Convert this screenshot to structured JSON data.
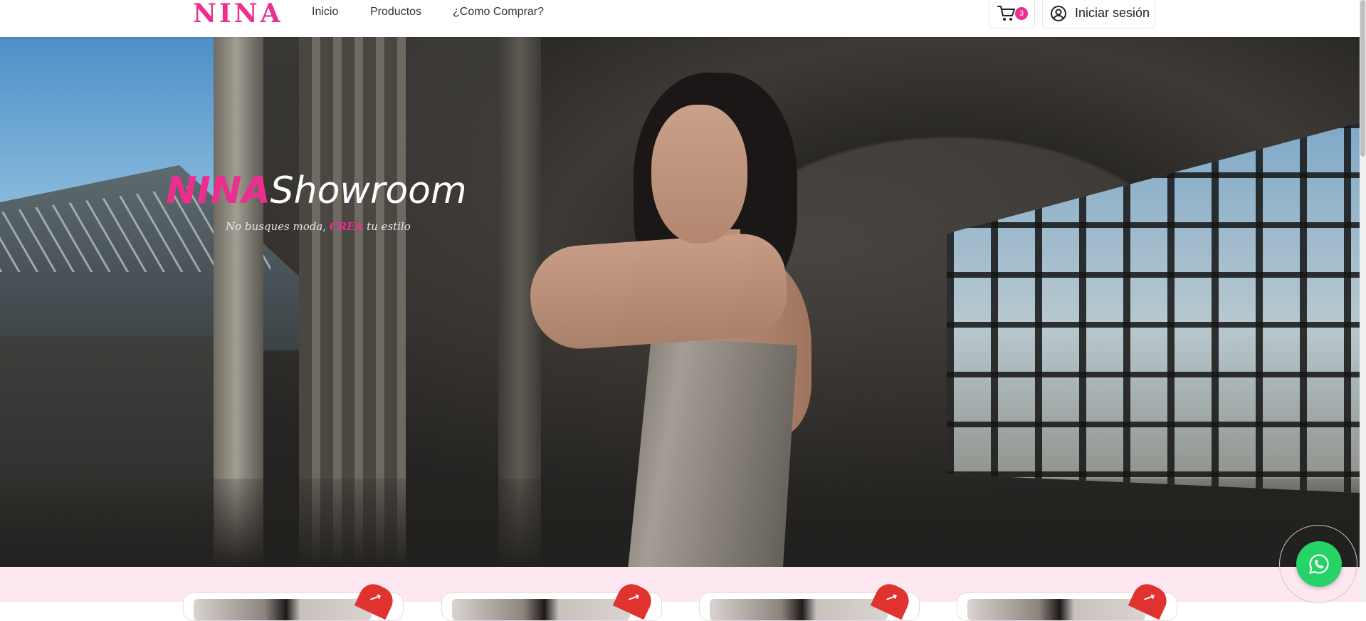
{
  "navbar": {
    "logo": "NINA",
    "links": [
      "Inicio",
      "Productos",
      "¿Como Comprar?"
    ],
    "cart": {
      "count": "3",
      "icon": "shopping-cart-icon"
    },
    "login": {
      "label": "Iniciar sesión",
      "icon": "user-circle-icon"
    }
  },
  "hero": {
    "brand": "NINA",
    "title_word": "Showroom",
    "subtitle_before": "No busques moda,",
    "subtitle_accent": "CREA",
    "subtitle_after": "tu estilo"
  },
  "colors": {
    "brand_pink": "#ec2f8f",
    "strip_pink": "#fde7f0",
    "whatsapp_green": "#25d366",
    "ribbon_red": "#e0322f"
  },
  "products": {
    "cards": [
      {
        "icon": "sale-tag-icon"
      },
      {
        "icon": "sale-tag-icon"
      },
      {
        "icon": "sale-tag-icon"
      },
      {
        "icon": "sale-tag-icon"
      }
    ]
  },
  "whatsapp": {
    "icon": "whatsapp-icon"
  }
}
